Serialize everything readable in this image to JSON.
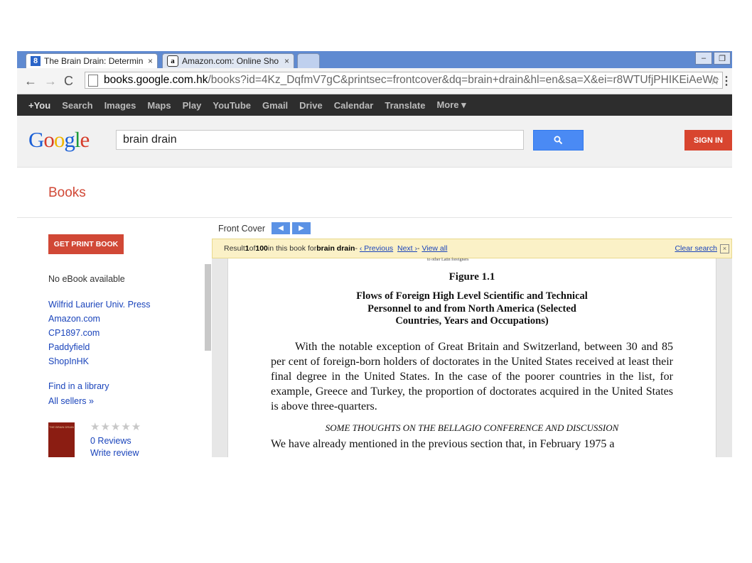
{
  "browser": {
    "tabs": [
      {
        "title": "The Brain Drain: Determin",
        "favicon": "google-books-icon",
        "close": "×"
      },
      {
        "title": "Amazon.com: Online Sho",
        "favicon": "amazon-icon",
        "close": "×"
      }
    ],
    "url_host": "books.google.com.hk",
    "url_path": "/books?id=4Kz_DqfmV7gC&printsec=frontcover&dq=brain+drain&hl=en&sa=X&ei=r8WTUfjPHIKEiAeWc"
  },
  "gbar": [
    "+You",
    "Search",
    "Images",
    "Maps",
    "Play",
    "YouTube",
    "Gmail",
    "Drive",
    "Calendar",
    "Translate",
    "More ▾"
  ],
  "search": {
    "value": "brain drain",
    "sign_in": "SIGN IN"
  },
  "books_title": "Books",
  "left": {
    "get_print": "GET PRINT BOOK",
    "no_ebook": "No eBook available",
    "sellers": [
      "Wilfrid Laurier Univ. Press",
      "Amazon.com",
      "CP1897.com",
      "Paddyfield",
      "ShopInHK"
    ],
    "find_library": "Find in a library",
    "all_sellers": "All sellers »",
    "stars": "★★★★★",
    "reviews": "0 Reviews",
    "write_review": "Write review",
    "thumb_title": "THE BRAIN DRAIN"
  },
  "viewer": {
    "front_cover": "Front Cover",
    "result_prefix": "Result ",
    "result_num": "1",
    "result_of": " of ",
    "result_total": "100",
    "result_mid": " in this book for ",
    "query": "brain drain",
    "sep1": " - ",
    "prev": "‹ Previous",
    "next": "Next ›",
    "sep2": " - ",
    "view_all": "View all",
    "clear": "Clear search"
  },
  "page": {
    "top_crop": "to other Latin foreigners",
    "figure": "Figure 1.1",
    "caption": [
      "Flows of Foreign High Level Scientific and Technical",
      "Personnel to and from North America (Selected",
      "Countries, Years and Occupations)"
    ],
    "body": "With the notable exception of Great Britain and Switzerland, between 30 and 85 per cent of foreign-born holders of doctorates in the United States received at least their final degree in the United States. In the case of the poorer countries in the list, for example, Greece and Turkey, the proportion of doctorates acquired in the United States is above three-quarters.",
    "section": "SOME THOUGHTS ON THE BELLAGIO CONFERENCE AND DISCUSSION",
    "last_line": "We have already mentioned in the previous section that, in February 1975 a"
  }
}
